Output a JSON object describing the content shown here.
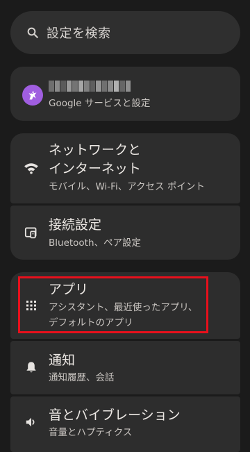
{
  "search": {
    "placeholder": "設定を検索",
    "icon": "search-icon"
  },
  "account": {
    "name_redacted": true,
    "subtitle": "Google サービスと設定",
    "avatar_color": "#a05ee0"
  },
  "items": [
    {
      "id": "network",
      "title_line1": "ネットワークと",
      "title_line2": "インターネット",
      "subtitle": "モバイル、Wi-Fi、アクセス ポイント",
      "icon": "wifi-icon"
    },
    {
      "id": "connected-devices",
      "title": "接続設定",
      "subtitle": "Bluetooth、ペア設定",
      "icon": "connected-devices-icon"
    },
    {
      "id": "apps",
      "title": "アプリ",
      "subtitle_line1": "アシスタント、最近使ったアプリ、",
      "subtitle_line2": "デフォルトのアプリ",
      "icon": "apps-grid-icon",
      "highlighted": true,
      "highlight_color": "#e8101c"
    },
    {
      "id": "notifications",
      "title": "通知",
      "subtitle": "通知履歴、会話",
      "icon": "bell-icon"
    },
    {
      "id": "sound",
      "title": "音とバイブレーション",
      "subtitle": "音量とハプティクス",
      "icon": "volume-icon"
    }
  ]
}
